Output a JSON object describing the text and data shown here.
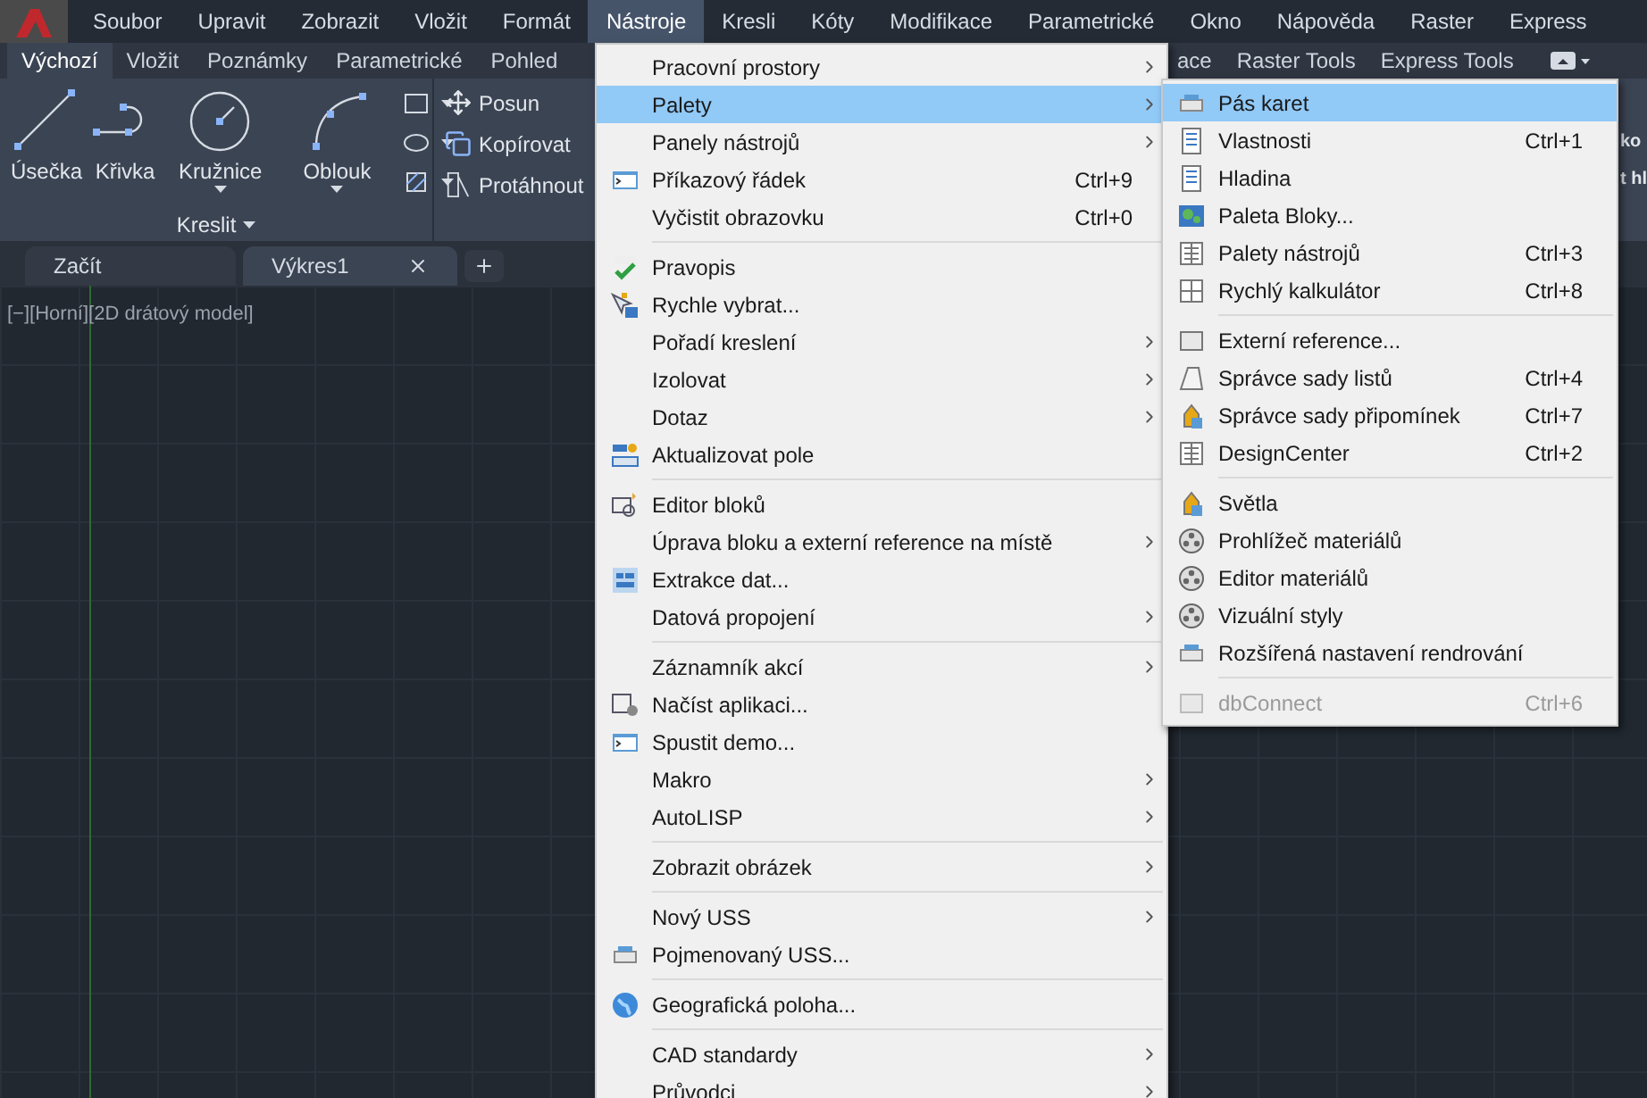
{
  "app_menu": [
    {
      "label": "Soubor",
      "selected": false
    },
    {
      "label": "Upravit",
      "selected": false
    },
    {
      "label": "Zobrazit",
      "selected": false
    },
    {
      "label": "Vložit",
      "selected": false
    },
    {
      "label": "Formát",
      "selected": false
    },
    {
      "label": "Nástroje",
      "selected": true
    },
    {
      "label": "Kresli",
      "selected": false
    },
    {
      "label": "Kóty",
      "selected": false
    },
    {
      "label": "Modifikace",
      "selected": false
    },
    {
      "label": "Parametrické",
      "selected": false
    },
    {
      "label": "Okno",
      "selected": false
    },
    {
      "label": "Nápověda",
      "selected": false
    },
    {
      "label": "Raster",
      "selected": false
    },
    {
      "label": "Express",
      "selected": false
    }
  ],
  "ribbon_tabs_left": [
    {
      "label": "Výchozí",
      "selected": true
    },
    {
      "label": "Vložit",
      "selected": false
    },
    {
      "label": "Poznámky",
      "selected": false
    },
    {
      "label": "Parametrické",
      "selected": false
    },
    {
      "label": "Pohled",
      "selected": false
    }
  ],
  "ribbon_tabs_right": [
    {
      "label": "ace",
      "selected": false
    },
    {
      "label": "Raster Tools",
      "selected": false
    },
    {
      "label": "Express Tools",
      "selected": false
    }
  ],
  "draw_tools": [
    {
      "label": "Úsečka",
      "dropdown": false
    },
    {
      "label": "Křivka",
      "dropdown": false
    },
    {
      "label": "Kružnice",
      "dropdown": true
    },
    {
      "label": "Oblouk",
      "dropdown": true
    }
  ],
  "draw_panel_title": "Kreslit",
  "modify_tools": [
    {
      "label": "Posun"
    },
    {
      "label": "Kopírovat"
    },
    {
      "label": "Protáhnout"
    }
  ],
  "cut_labels": [
    "ko",
    "t hl"
  ],
  "doc_tabs": [
    {
      "label": "Začít",
      "selected": false,
      "closable": false
    },
    {
      "label": "Výkres1",
      "selected": true,
      "closable": true
    }
  ],
  "viewport_label": "[−][Horní][2D drátový model]",
  "tools_menu": {
    "groups": [
      {
        "items": [
          {
            "label": "Pracovní prostory",
            "submenu": true,
            "selected": false
          },
          {
            "label": "Palety",
            "submenu": true,
            "selected": true
          },
          {
            "label": "Panely nástrojů",
            "submenu": true,
            "selected": false
          },
          {
            "label": "Příkazový řádek",
            "shortcut": "Ctrl+9",
            "submenu": false,
            "selected": false
          },
          {
            "label": "Vyčistit obrazovku",
            "shortcut": "Ctrl+0",
            "submenu": false,
            "selected": false
          }
        ]
      },
      {
        "items": [
          {
            "label": "Pravopis",
            "submenu": false,
            "selected": false
          },
          {
            "label": "Rychle vybrat...",
            "submenu": false,
            "selected": false
          },
          {
            "label": "Pořadí kreslení",
            "submenu": true,
            "selected": false
          },
          {
            "label": "Izolovat",
            "submenu": true,
            "selected": false
          },
          {
            "label": "Dotaz",
            "submenu": true,
            "selected": false
          },
          {
            "label": "Aktualizovat pole",
            "submenu": false,
            "selected": false
          }
        ]
      },
      {
        "items": [
          {
            "label": "Editor bloků",
            "submenu": false,
            "selected": false
          },
          {
            "label": "Úprava bloku a externí reference na místě",
            "submenu": true,
            "selected": false
          },
          {
            "label": "Extrakce dat...",
            "submenu": false,
            "selected": false
          },
          {
            "label": "Datová propojení",
            "submenu": true,
            "selected": false
          }
        ]
      },
      {
        "items": [
          {
            "label": "Záznamník akcí",
            "submenu": true,
            "selected": false
          },
          {
            "label": "Načíst aplikaci...",
            "submenu": false,
            "selected": false
          },
          {
            "label": "Spustit demo...",
            "submenu": false,
            "selected": false
          },
          {
            "label": "Makro",
            "submenu": true,
            "selected": false
          },
          {
            "label": "AutoLISP",
            "submenu": true,
            "selected": false
          }
        ]
      },
      {
        "items": [
          {
            "label": "Zobrazit obrázek",
            "submenu": true,
            "selected": false
          }
        ]
      },
      {
        "items": [
          {
            "label": "Nový USS",
            "submenu": true,
            "selected": false
          },
          {
            "label": "Pojmenovaný USS...",
            "submenu": false,
            "selected": false
          }
        ]
      },
      {
        "items": [
          {
            "label": "Geografická poloha...",
            "submenu": false,
            "selected": false
          }
        ]
      },
      {
        "items": [
          {
            "label": "CAD standardy",
            "submenu": true,
            "selected": false
          },
          {
            "label": "Průvodci",
            "submenu": true,
            "selected": false
          }
        ]
      }
    ]
  },
  "palettes_submenu": {
    "groups": [
      {
        "items": [
          {
            "label": "Pás karet",
            "selected": true,
            "disabled": false
          },
          {
            "label": "Vlastnosti",
            "shortcut": "Ctrl+1",
            "selected": false,
            "disabled": false
          },
          {
            "label": "Hladina",
            "selected": false,
            "disabled": false
          },
          {
            "label": "Paleta Bloky...",
            "selected": false,
            "disabled": false
          },
          {
            "label": "Palety nástrojů",
            "shortcut": "Ctrl+3",
            "selected": false,
            "disabled": false
          },
          {
            "label": "Rychlý kalkulátor",
            "shortcut": "Ctrl+8",
            "selected": false,
            "disabled": false
          }
        ]
      },
      {
        "items": [
          {
            "label": "Externí reference...",
            "selected": false,
            "disabled": false
          },
          {
            "label": "Správce sady listů",
            "shortcut": "Ctrl+4",
            "selected": false,
            "disabled": false
          },
          {
            "label": "Správce sady připomínek",
            "shortcut": "Ctrl+7",
            "selected": false,
            "disabled": false
          },
          {
            "label": "DesignCenter",
            "shortcut": "Ctrl+2",
            "selected": false,
            "disabled": false
          }
        ]
      },
      {
        "items": [
          {
            "label": "Světla",
            "selected": false,
            "disabled": false
          },
          {
            "label": "Prohlížeč materiálů",
            "selected": false,
            "disabled": false
          },
          {
            "label": "Editor materiálů",
            "selected": false,
            "disabled": false
          },
          {
            "label": "Vizuální styly",
            "selected": false,
            "disabled": false
          },
          {
            "label": "Rozšířená nastavení rendrování",
            "selected": false,
            "disabled": false
          }
        ]
      },
      {
        "items": [
          {
            "label": "dbConnect",
            "shortcut": "Ctrl+6",
            "selected": false,
            "disabled": true
          }
        ]
      }
    ]
  }
}
